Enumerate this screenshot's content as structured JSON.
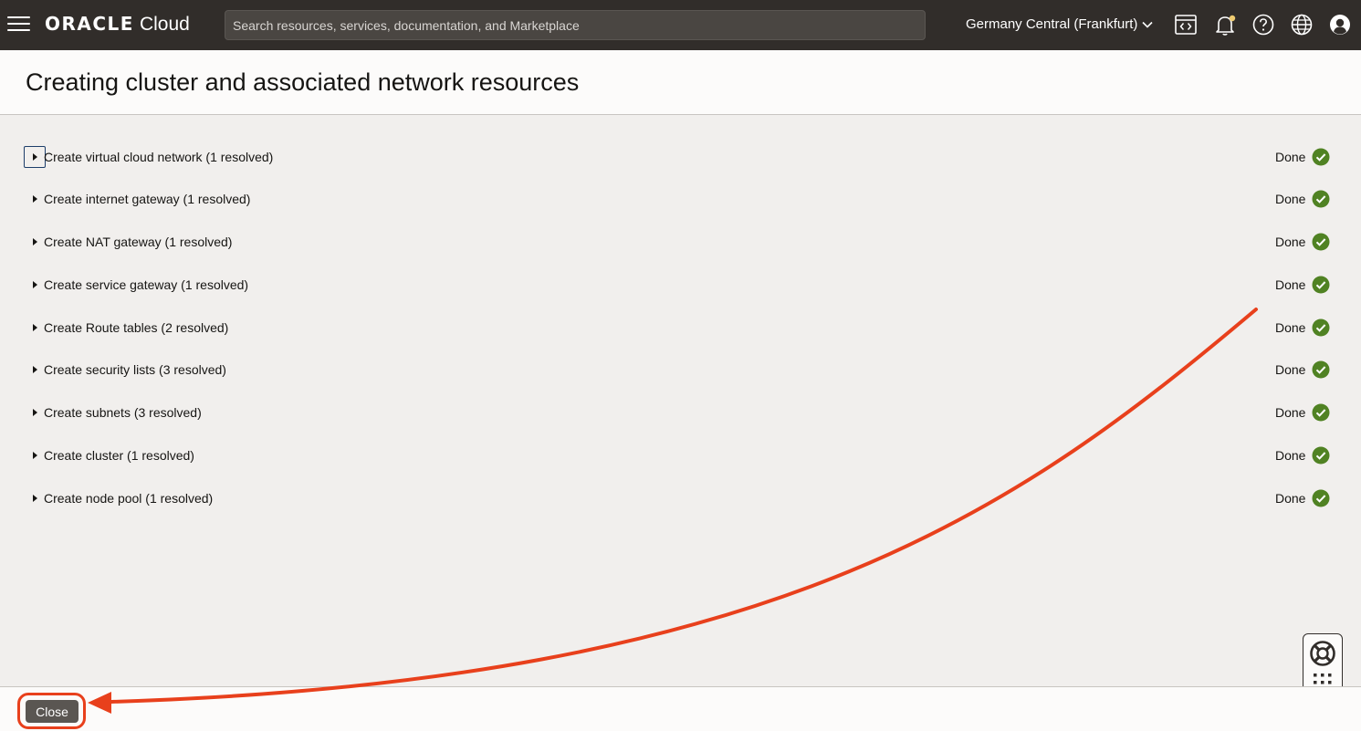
{
  "topbar": {
    "brand_oracle": "ORACLE",
    "brand_cloud": "Cloud",
    "search_placeholder": "Search resources, services, documentation, and Marketplace",
    "region": "Germany Central (Frankfurt)",
    "icons": [
      "menu-icon",
      "code-editor-icon",
      "notification-bell-icon",
      "help-icon",
      "language-globe-icon",
      "user-profile-icon"
    ]
  },
  "page": {
    "title": "Creating cluster and associated network resources"
  },
  "steps": [
    {
      "label": "Create virtual cloud network (1 resolved)",
      "status": "Done"
    },
    {
      "label": "Create internet gateway (1 resolved)",
      "status": "Done"
    },
    {
      "label": "Create NAT gateway (1 resolved)",
      "status": "Done"
    },
    {
      "label": "Create service gateway (1 resolved)",
      "status": "Done"
    },
    {
      "label": "Create Route tables (2 resolved)",
      "status": "Done"
    },
    {
      "label": "Create security lists (3 resolved)",
      "status": "Done"
    },
    {
      "label": "Create subnets (3 resolved)",
      "status": "Done"
    },
    {
      "label": "Create cluster (1 resolved)",
      "status": "Done"
    },
    {
      "label": "Create node pool (1 resolved)",
      "status": "Done"
    }
  ],
  "footer": {
    "close_label": "Close"
  },
  "colors": {
    "topbar_bg": "#312d2a",
    "success_green": "#508223",
    "annotation_red": "#e8401c",
    "button_bg": "#5a5652"
  }
}
